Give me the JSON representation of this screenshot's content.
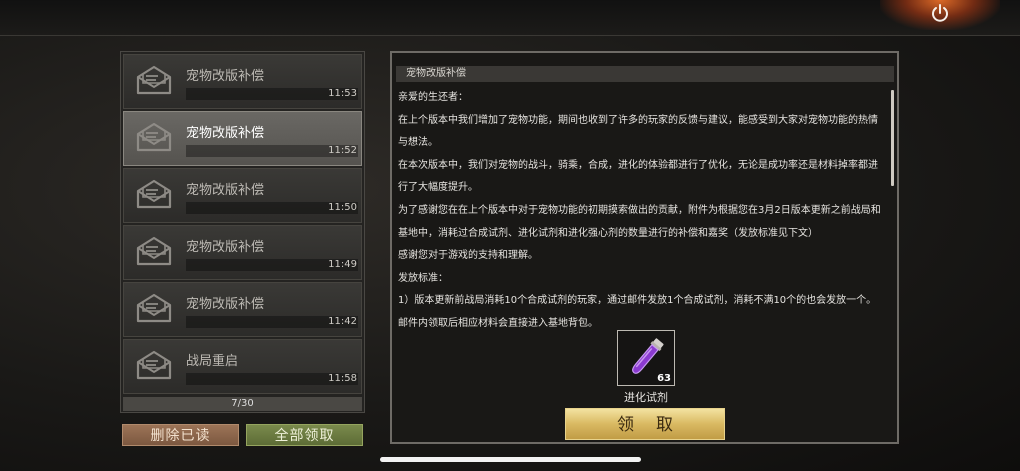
{
  "mail_list": {
    "items": [
      {
        "title": "宠物改版补偿",
        "time": "11:53",
        "selected": false
      },
      {
        "title": "宠物改版补偿",
        "time": "11:52",
        "selected": true
      },
      {
        "title": "宠物改版补偿",
        "time": "11:50",
        "selected": false
      },
      {
        "title": "宠物改版补偿",
        "time": "11:49",
        "selected": false
      },
      {
        "title": "宠物改版补偿",
        "time": "11:42",
        "selected": false
      },
      {
        "title": "战局重启",
        "time": "11:58",
        "selected": false
      }
    ],
    "page_count": "7/30"
  },
  "buttons": {
    "delete_read": "删除已读",
    "claim_all": "全部领取",
    "claim": "领取"
  },
  "detail": {
    "header": "宠物改版补偿",
    "paragraphs": [
      "亲爱的生还者：",
      "在上个版本中我们增加了宠物功能，期间也收到了许多的玩家的反馈与建议，能感受到大家对宠物功能的热情与想法。",
      "在本次版本中，我们对宠物的战斗，骑乘，合成，进化的体验都进行了优化，无论是成功率还是材料掉率都进行了大幅度提升。",
      "为了感谢您在在上个版本中对于宠物功能的初期摸索做出的贡献，附件为根据您在3月2日版本更新之前战局和基地中，消耗过合成试剂、进化试剂和进化强心剂的数量进行的补偿和嘉奖（发放标准见下文）",
      "感谢您对于游戏的支持和理解。",
      "发放标准：",
      "1）版本更新前战局消耗10个合成试剂的玩家，通过邮件发放1个合成试剂，消耗不满10个的也会发放一个。邮件内领取后相应材料会直接进入基地背包。"
    ],
    "attachment": {
      "name": "进化试剂",
      "count": "63",
      "icon": "potion-vial-icon"
    }
  },
  "colors": {
    "accent_gold": "#d9b962",
    "delete_button": "#9c7457",
    "claim_all_button": "#7a8a4c"
  }
}
